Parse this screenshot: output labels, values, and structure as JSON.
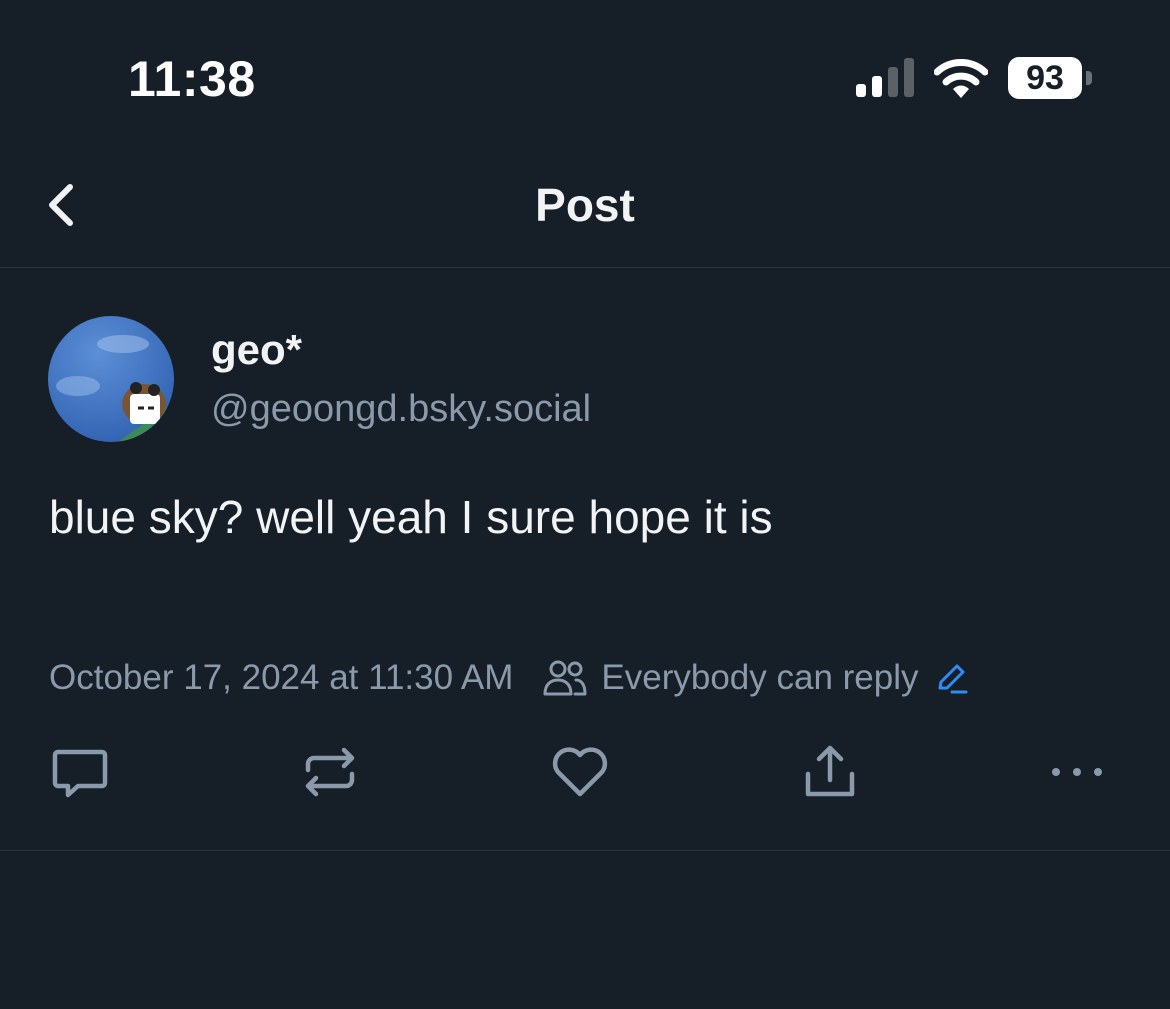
{
  "status_bar": {
    "time": "11:38",
    "battery": "93",
    "signal_icon": "cellular-signal-icon",
    "wifi_icon": "wifi-icon"
  },
  "header": {
    "title": "Post",
    "back_icon": "chevron-left-icon"
  },
  "post": {
    "display_name": "geo*",
    "handle": "@geoongd.bsky.social",
    "text": "blue sky? well yeah I sure hope it is",
    "timestamp": "October 17, 2024 at 11:30 AM",
    "reply_setting": "Everybody can reply",
    "actions": [
      "reply-icon",
      "repost-icon",
      "like-icon",
      "share-icon",
      "more-icon"
    ]
  },
  "colors": {
    "background": "#161e27",
    "text_primary": "#f1f3f5",
    "text_secondary": "#8a9aab",
    "accent": "#2f8cf5",
    "divider": "#2a3541"
  }
}
